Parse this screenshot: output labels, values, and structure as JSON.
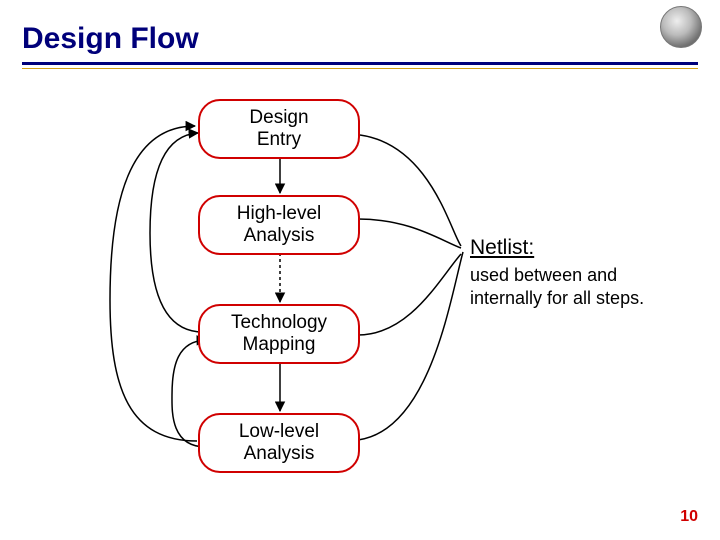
{
  "slide": {
    "title": "Design Flow",
    "page_number": "10"
  },
  "nodes": {
    "design_entry": "Design\nEntry",
    "high_level": "High-level\nAnalysis",
    "tech_mapping": "Technology\nMapping",
    "low_level": "Low-level\nAnalysis"
  },
  "annotation": {
    "title": "Netlist:",
    "body": "used between and internally for all steps."
  }
}
